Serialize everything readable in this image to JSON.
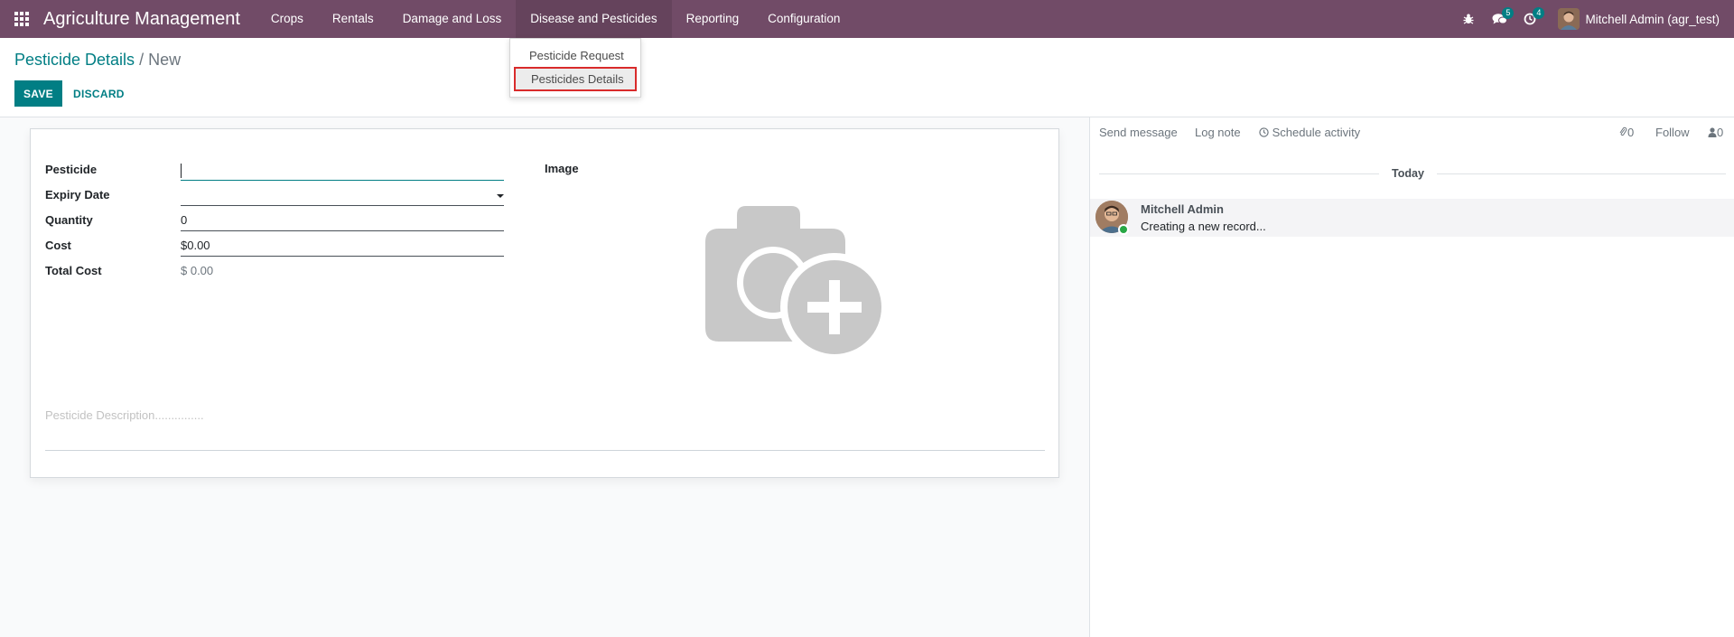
{
  "navbar": {
    "brand": "Agriculture Management",
    "menu": [
      "Crops",
      "Rentals",
      "Damage and Loss",
      "Disease and Pesticides",
      "Reporting",
      "Configuration"
    ],
    "messages_count": "5",
    "activities_count": "4",
    "user": "Mitchell Admin (agr_test)"
  },
  "dropdown": {
    "items": [
      "Pesticide Request",
      "Pesticides Details"
    ]
  },
  "breadcrumb": {
    "parent": "Pesticide Details",
    "separator": "/",
    "current": "New"
  },
  "buttons": {
    "save": "Save",
    "discard": "Discard"
  },
  "form": {
    "fields": [
      {
        "label": "Pesticide",
        "value": ""
      },
      {
        "label": "Expiry Date",
        "value": ""
      },
      {
        "label": "Quantity",
        "value": "0"
      },
      {
        "label": "Cost",
        "value": "$0.00"
      },
      {
        "label": "Total Cost",
        "value": "$ 0.00"
      }
    ],
    "image_label": "Image",
    "description_placeholder": "Pesticide Description..............."
  },
  "chatter": {
    "send_message": "Send message",
    "log_note": "Log note",
    "schedule_activity": "Schedule activity",
    "attachments_count": "0",
    "follow": "Follow",
    "followers_count": "0",
    "date_separator": "Today",
    "message": {
      "author": "Mitchell Admin",
      "body": "Creating a new record..."
    }
  },
  "colors": {
    "navbar": "#714b67",
    "primary": "#017e84",
    "highlight_border": "#d92b2b"
  }
}
